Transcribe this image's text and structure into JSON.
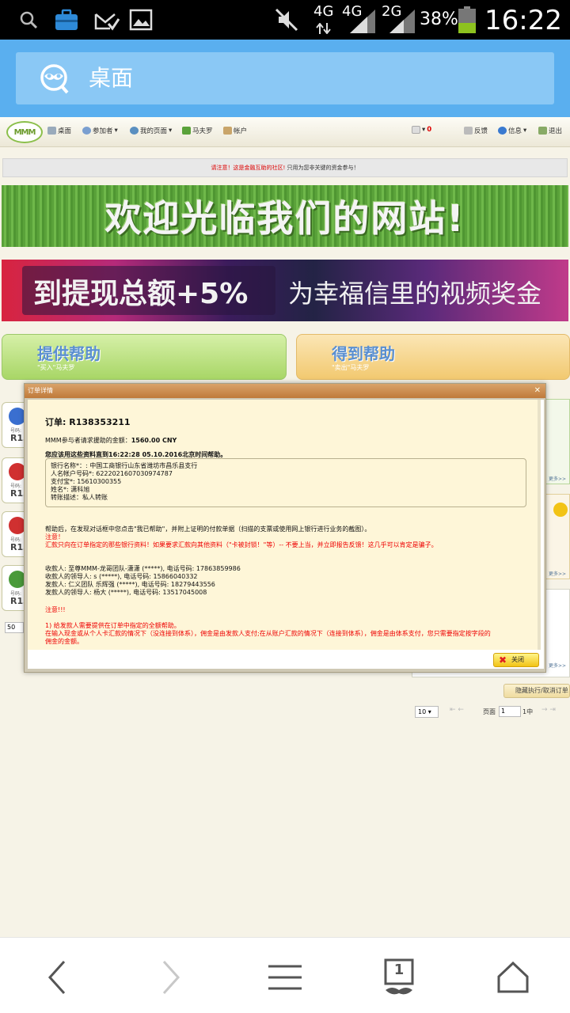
{
  "status_bar": {
    "icons": [
      "search-icon",
      "toolbox-icon",
      "mail-check-icon",
      "image-icon",
      "mute-icon"
    ],
    "net1": "4G",
    "net2": "4G",
    "net3": "2G",
    "battery": "38%",
    "time": "16:22"
  },
  "browser": {
    "title": "桌面",
    "tabs_count": "1"
  },
  "site_nav": {
    "logo": "MMM",
    "items": [
      "桌面",
      "参加者",
      "我的页面",
      "马夫罗",
      "帐户"
    ],
    "messages_count": "0",
    "right_items": [
      "反馈",
      "信息",
      "退出"
    ]
  },
  "notice": {
    "red": "请注意！这是金融互助的社区!",
    "black": " 只用为您非关键的资金参与！"
  },
  "banners": {
    "welcome": "欢迎光临我们的网站!",
    "promo_left": "到提现总额",
    "promo_plus": "+5%",
    "promo_right": "为幸福信里的视频奖金"
  },
  "help_buttons": {
    "provide_label": "提供帮助",
    "provide_sub": "\"买入\"马夫罗",
    "get_label": "得到帮助",
    "get_sub": "\"卖出\"马夫罗"
  },
  "side_cards": [
    {
      "n": "号码:",
      "r": "R13"
    },
    {
      "n": "号码:",
      "r": "R13"
    },
    {
      "n": "号码:",
      "r": "R13"
    },
    {
      "n": "号码:",
      "r": "R13"
    }
  ],
  "background_controls": {
    "page_size": "50",
    "more_1": "更多>>",
    "more_2": "更多>>",
    "more_3": "更多>>",
    "hide_exec": "隐藏执行/取消订单",
    "pager_size": "10",
    "page_label": "页面",
    "page_value": "1",
    "page_of": "1中"
  },
  "modal": {
    "title": "订单详情",
    "order_number": "订单: R138353211",
    "amount_label": "MMM参与者请求援助的金额：",
    "amount_value": "1560.00 CNY",
    "deadline": "您应该用这些资料直到16:22:28 05.10.2016北京时间帮助。",
    "bank_lines": [
      "银行名称*：: 中国工商银行山东省潍坊市昌乐县支行",
      "人名帐户号码*: 6222021607030974787",
      "支付宝*: 15610300355",
      "姓名*: 潇科旭",
      "转账描述：私人转账"
    ],
    "instruction": "帮助后，在发现对话框中您点击\"我已帮助\"，并附上证明的付款单据（扫描的支票或使用网上银行进行业务的截图）。",
    "attention_1": "注意！",
    "warning": "汇款只向在订单指定的那些银行资料！如果要求汇款向其他资料（\"卡被封锁！\"等）-- 不要上当，并立即报告反馈！这几乎可以肯定是骗子。",
    "contacts": [
      "收款人: 至尊MMM-龙哥团队-潇潇 (*****), 电话号码: 17863859986",
      "收款人的领导人: s (*****), 电话号码: 15866040332",
      "发款人: 仁义团队 乐辉强 (*****), 电话号码: 18279443556",
      "发款人的领导人: 杨大 (*****), 电话号码: 13517045008"
    ],
    "attention_2": "注意!!!",
    "note_1": "1) 给发款人需要提供在订单中指定的全额帮助。",
    "note_2": "在输入现金或从个人卡汇款的情况下（没连接到体系），佣金是由发款人支付;在从账户汇款的情况下（连接到体系），佣金是由体系支付，您只需要指定按字段的",
    "note_3": "佣金的金额。",
    "close_label": "关闭"
  },
  "colors": {
    "browser_bar": "#5aafef",
    "provide_btn": "#b5e07a",
    "get_btn": "#f5d48a",
    "modal_header": "#c98a4a",
    "warning_red": "#e00000"
  }
}
